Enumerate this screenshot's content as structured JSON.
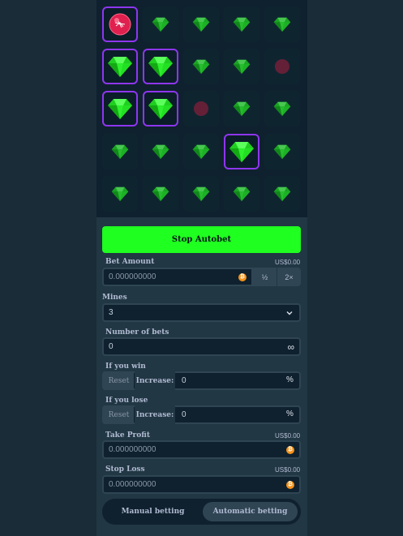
{
  "board": {
    "tiles": [
      [
        "mine-hit",
        "gem",
        "gem",
        "gem",
        "gem"
      ],
      [
        "gem-found",
        "gem-found",
        "gem",
        "gem",
        "mine"
      ],
      [
        "gem-found",
        "gem-found",
        "mine",
        "gem",
        "gem"
      ],
      [
        "gem",
        "gem",
        "gem",
        "gem-found",
        "gem"
      ],
      [
        "gem",
        "gem",
        "gem",
        "gem",
        "gem"
      ]
    ]
  },
  "actions": {
    "start_label": "Stop Autobet"
  },
  "bet_amount": {
    "label": "Bet Amount",
    "usd": "US$0.00",
    "value": "0.000000000",
    "half": "½",
    "double": "2×"
  },
  "mines": {
    "label": "Mines",
    "value": "3"
  },
  "number_of_bets": {
    "label": "Number of bets",
    "value": "0",
    "infinity": "∞"
  },
  "on_win": {
    "label": "If you win",
    "reset": "Reset",
    "increase": "Increase:",
    "value": "0",
    "unit": "%"
  },
  "on_loss": {
    "label": "If you lose",
    "reset": "Reset",
    "increase": "Increase:",
    "value": "0",
    "unit": "%"
  },
  "take_profit": {
    "label": "Take Profit",
    "usd": "US$0.00",
    "value": "0.000000000"
  },
  "stop_loss": {
    "label": "Stop Loss",
    "usd": "US$0.00",
    "value": "0.000000000"
  },
  "mode_tabs": {
    "manual": "Manual betting",
    "automatic": "Automatic betting",
    "active": "automatic"
  },
  "colors": {
    "accent": "#1fff20",
    "selected_border": "#8e36f0",
    "gem": "#2ee62e",
    "mine": "#e0204e",
    "coin": "#f7931a"
  },
  "icons": {
    "gem": "gem-icon",
    "mine": "mine-icon",
    "coin": "bitcoin-icon",
    "chevron": "chevron-down-icon",
    "infinity": "infinity-icon"
  }
}
